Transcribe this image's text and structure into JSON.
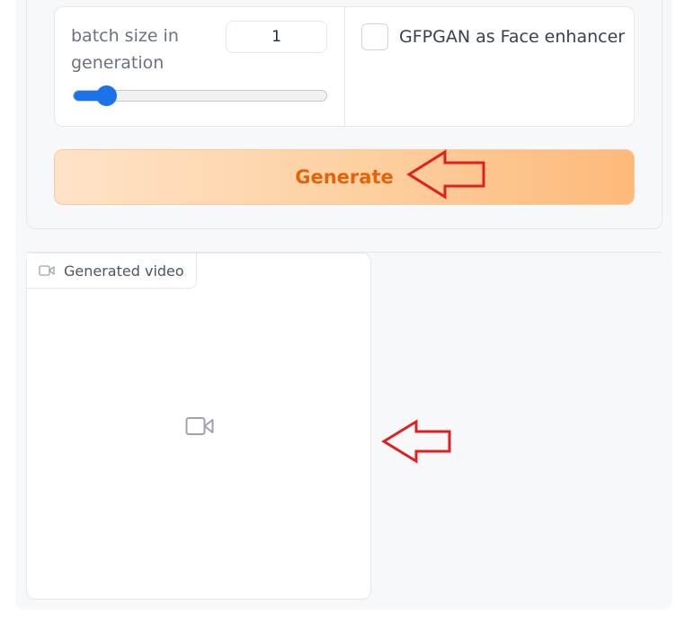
{
  "batch_size": {
    "label": "batch size in generation",
    "value": "1",
    "slider_fraction": 0.13
  },
  "face_enhancer": {
    "label": "GFPGAN as Face enhancer",
    "checked": false
  },
  "generate_button": {
    "label": "Generate"
  },
  "video_output": {
    "label": "Generated video",
    "label_icon": "video-camera-icon",
    "placeholder_icon": "video-camera-icon"
  },
  "annotations": {
    "arrow_color": "#e02020"
  },
  "colors": {
    "accent": "#1a73e8",
    "button_text": "#e2650c"
  }
}
